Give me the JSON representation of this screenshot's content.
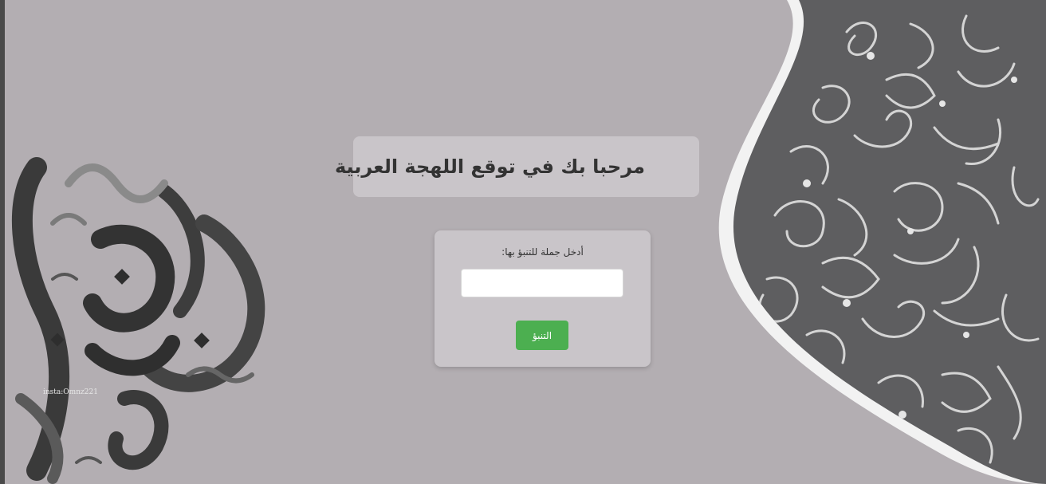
{
  "page": {
    "background_color": "#b3aeb2"
  },
  "header": {
    "title": "مرحبا بك في توقع اللهجة العربية"
  },
  "form": {
    "prompt_label": ":أدخل جملة للتنبؤ بها",
    "input_value": "",
    "input_placeholder": "",
    "submit_label": "التنبؤ",
    "submit_color": "#4caf50"
  },
  "decor": {
    "watermark_text": "insta:Omnz221",
    "left_art_icon": "arabic-calligraphy-art",
    "right_art_icon": "arabic-calligraphy-dome-art"
  }
}
